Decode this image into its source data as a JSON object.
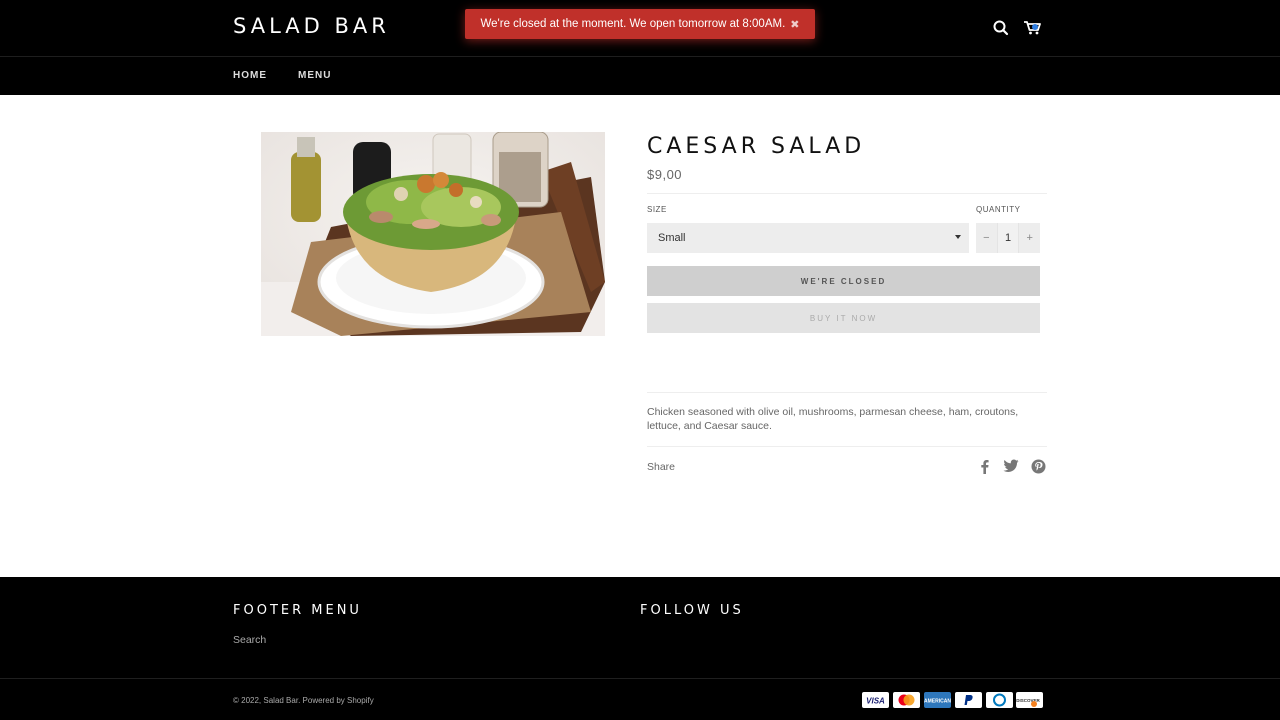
{
  "header": {
    "logo": "SALAD BAR",
    "notice": "We're closed at the moment. We open tomorrow at 8:00AM.",
    "notice_close": "✖",
    "nav": [
      "HOME",
      "MENU"
    ]
  },
  "product": {
    "title": "CAESAR SALAD",
    "price": "$9,00",
    "size_label": "SIZE",
    "size_value": "Small",
    "quantity_label": "QUANTITY",
    "quantity": "1",
    "minus": "−",
    "plus": "+",
    "closed_button": "WE'RE CLOSED",
    "buy_button": "BUY IT NOW",
    "description": "Chicken seasoned with olive oil, mushrooms, parmesan cheese, ham, croutons, lettuce, and Caesar sauce.",
    "share_label": "Share"
  },
  "footer": {
    "menu_heading": "FOOTER MENU",
    "follow_heading": "FOLLOW US",
    "links": [
      "Search"
    ],
    "copyright_prefix": "© 2022,",
    "store_link": "Salad Bar",
    "powered": "Powered by Shopify"
  },
  "payment_icons": [
    "visa-icon",
    "mastercard-icon",
    "amex-icon",
    "paypal-icon",
    "diners-icon",
    "discover-icon"
  ],
  "colors": {
    "header_bg": "#000000",
    "notice_bg": "#c0302a",
    "button_closed": "#cfcfcf",
    "button_buy": "#e3e3e3"
  }
}
